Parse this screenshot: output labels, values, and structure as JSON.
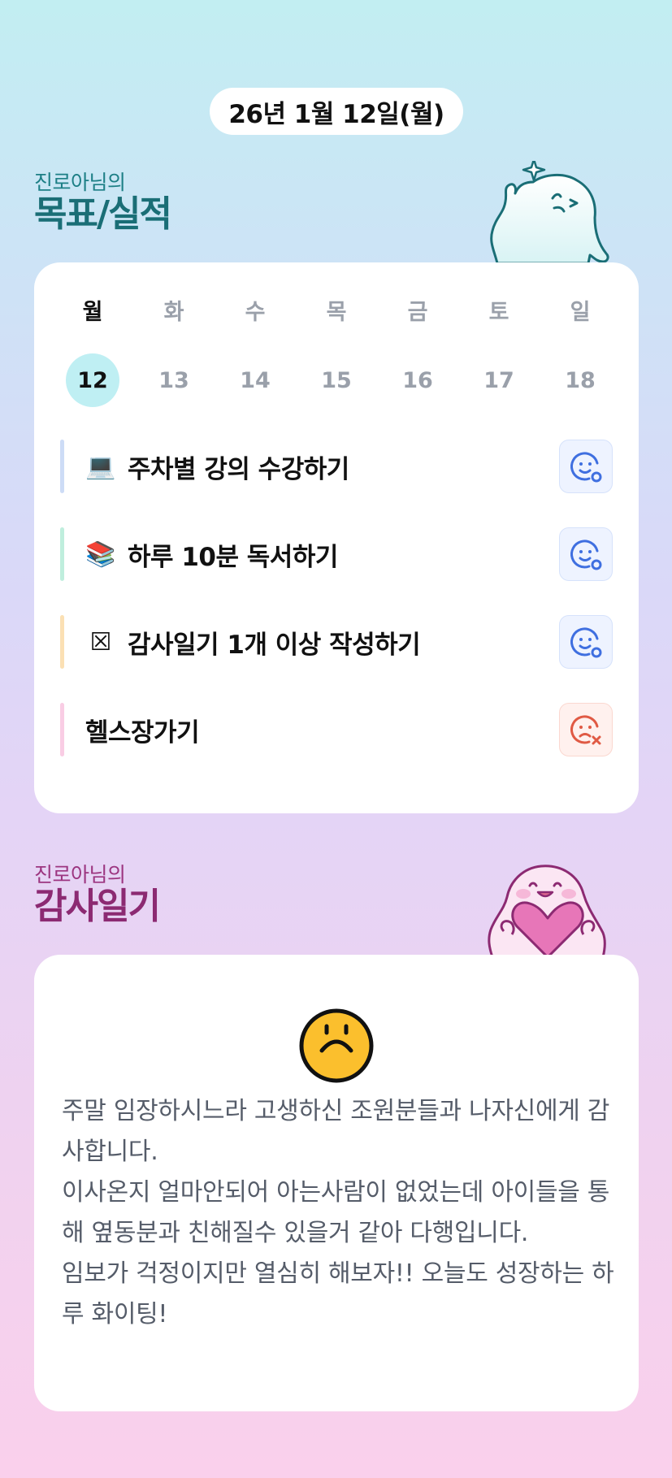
{
  "header": {
    "date": "26년 1월 12일(월)"
  },
  "goals_section": {
    "subtitle": "진로아님의",
    "title": "목표/실적"
  },
  "week": [
    {
      "label": "월",
      "num": "12",
      "active": true
    },
    {
      "label": "화",
      "num": "13",
      "active": false
    },
    {
      "label": "수",
      "num": "14",
      "active": false
    },
    {
      "label": "목",
      "num": "15",
      "active": false
    },
    {
      "label": "금",
      "num": "16",
      "active": false
    },
    {
      "label": "토",
      "num": "17",
      "active": false
    },
    {
      "label": "일",
      "num": "18",
      "active": false
    }
  ],
  "goals": [
    {
      "emoji": "💻",
      "text": "주차별 강의 수강하기",
      "bar_color": "#cddcf6",
      "status": "done"
    },
    {
      "emoji": "📚",
      "text": "하루 10분 독서하기",
      "bar_color": "#bfeedd",
      "status": "done"
    },
    {
      "emoji": "☒",
      "text": "감사일기 1개 이상 작성하기",
      "bar_color": "#fbe0b4",
      "status": "done"
    },
    {
      "emoji": "",
      "text": "헬스장가기",
      "bar_color": "#f9cde4",
      "status": "failed"
    }
  ],
  "diary_section": {
    "subtitle": "진로아님의",
    "title": "감사일기"
  },
  "diary": {
    "emoji_icon": "upside-down-face-icon",
    "text": "주말 임장하시느라 고생하신 조원분들과 나자신에게 감사합니다.\n이사온지 얼마안되어 아는사람이 없었는데 아이들을 통해 옆동분과 친해질수 있을거 같아 다행입니다.\n임보가 걱정이지만 열심히 해보자!! 오늘도 성장하는 하루 화이팅!"
  },
  "colors": {
    "accent_teal": "#1a6e76",
    "accent_plum": "#8c2a72",
    "ok_icon": "#3f6fe0",
    "bad_icon": "#e05a44"
  }
}
